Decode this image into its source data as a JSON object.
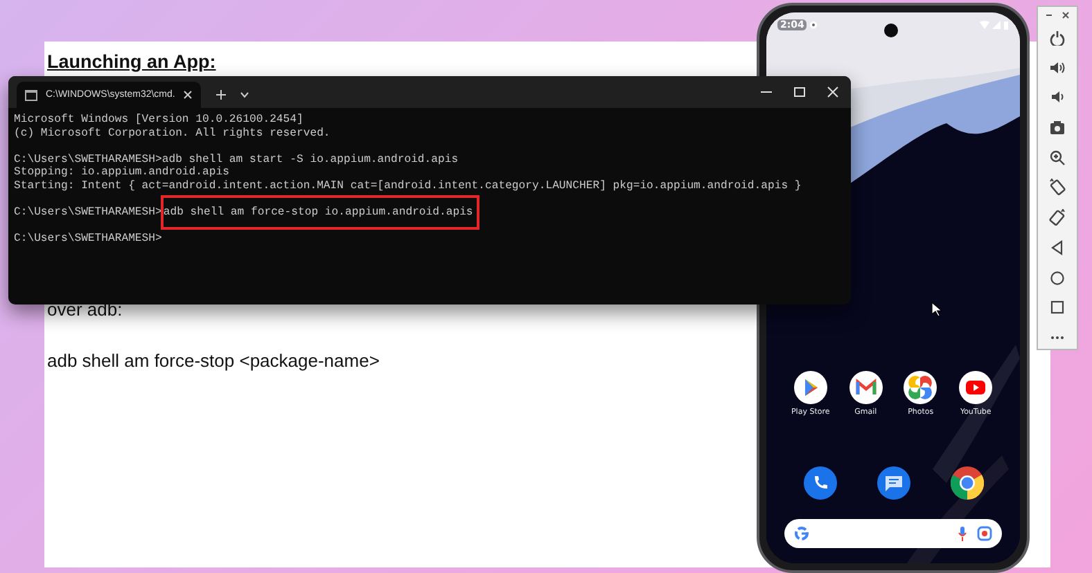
{
  "document": {
    "heading": "Launching an App:",
    "lines": [
      "over adb:",
      "adb shell am force-stop <package-name>"
    ]
  },
  "terminal": {
    "tabs": [
      {
        "label": "C:\\WINDOWS\\system32\\cmd.",
        "selected": true
      }
    ],
    "blocks": [
      [
        {
          "kind": "output",
          "text": "Microsoft Windows [Version 10.0.26100.2454]"
        },
        {
          "kind": "output",
          "text": "(c) Microsoft Corporation. All rights reserved."
        }
      ],
      [
        {
          "kind": "prompt",
          "prompt": "C:\\Users\\SWETHARAMESH>",
          "command": "adb shell am start -S io.appium.android.apis",
          "highlighted": false
        },
        {
          "kind": "output",
          "text": "Stopping: io.appium.android.apis"
        },
        {
          "kind": "output",
          "text": "Starting: Intent { act=android.intent.action.MAIN cat=[android.intent.category.LAUNCHER] pkg=io.appium.android.apis }"
        }
      ],
      [
        {
          "kind": "prompt",
          "prompt": "C:\\Users\\SWETHARAMESH>",
          "command": "adb shell am force-stop io.appium.android.apis",
          "highlighted": true
        }
      ],
      [
        {
          "kind": "prompt",
          "prompt": "C:\\Users\\SWETHARAMESH>"
        }
      ]
    ]
  },
  "phone": {
    "status_time": "2:04",
    "apps": [
      {
        "label": "Play Store",
        "kind": "play"
      },
      {
        "label": "Gmail",
        "kind": "mail"
      },
      {
        "label": "Photos",
        "kind": "pinwheel"
      },
      {
        "label": "YouTube",
        "kind": "video"
      }
    ],
    "dock": [
      {
        "kind": "phone"
      },
      {
        "kind": "chat"
      },
      {
        "kind": "browser"
      }
    ]
  },
  "emulator_toolbar": {
    "buttons": [
      {
        "kind": "power"
      },
      {
        "kind": "volume-up"
      },
      {
        "kind": "volume-down"
      },
      {
        "kind": "camera"
      },
      {
        "kind": "zoom"
      },
      {
        "kind": "rotate-left"
      },
      {
        "kind": "rotate-right"
      },
      {
        "kind": "back"
      },
      {
        "kind": "home"
      },
      {
        "kind": "overview"
      },
      {
        "kind": "more"
      }
    ]
  }
}
